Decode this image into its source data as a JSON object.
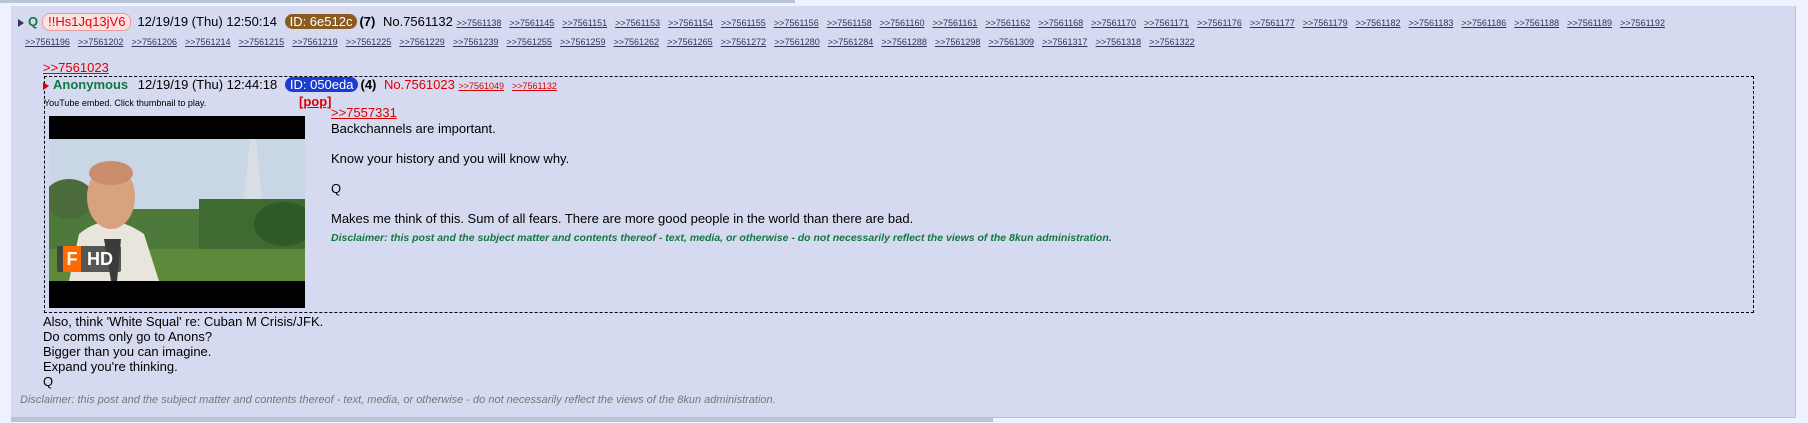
{
  "post": {
    "name": "Q",
    "tripcode": "!!Hs1Jq13jV6",
    "datetime": "12/19/19 (Thu) 12:50:14",
    "id": "ID: 6e512c",
    "id_color": "#8a5a1e",
    "reply_count": "(7)",
    "number": "No.7561132",
    "backlinks_row1": [
      ">>7561138",
      ">>7561145",
      ">>7561151",
      ">>7561153",
      ">>7561154",
      ">>7561155",
      ">>7561156",
      ">>7561158",
      ">>7561160",
      ">>7561161",
      ">>7561162",
      ">>7561168",
      ">>7561170",
      ">>7561171",
      ">>7561176",
      ">>7561177",
      ">>7561179",
      ">>7561182",
      ">>7561183",
      ">>7561186",
      ">>7561188",
      ">>7561189",
      ">>7561192"
    ],
    "backlinks_row2": [
      ">>7561196",
      ">>7561202",
      ">>7561206",
      ">>7561214",
      ">>7561215",
      ">>7561219",
      ">>7561225",
      ">>7561229",
      ">>7561239",
      ">>7561255",
      ">>7561259",
      ">>7561262",
      ">>7561265",
      ">>7561272",
      ">>7561280",
      ">>7561284",
      ">>7561288",
      ">>7561298",
      ">>7561309",
      ">>7561317",
      ">>7561318",
      ">>7561322"
    ],
    "quote_link": ">>7561023",
    "body_lines": [
      "Also, think 'White Squal' re: Cuban M Crisis/JFK.",
      "Do comms only go to Anons?",
      "Bigger than you can imagine.",
      "Expand you're thinking.",
      "Q"
    ],
    "disclaimer": "Disclaimer: this post and the subject matter and contents thereof - text, media, or otherwise - do not necessarily reflect the views of the 8kun administration."
  },
  "inline_post": {
    "name": "Anonymous",
    "datetime": "12/19/19 (Thu) 12:44:18",
    "id": "ID: 050eda",
    "id_color": "#1b3bd1",
    "reply_count": "(4)",
    "number": "No.7561023",
    "backlinks": [
      ">>7561049",
      ">>7561132"
    ],
    "embed_note": "YouTube embed. Click thumbnail to play.",
    "pop_label": "[pop]",
    "hd_label": "HD",
    "hd_logo": "F",
    "quote_link": ">>7557331",
    "body_lines": [
      "Backchannels are important.",
      "Know your history and you will know why.",
      "Q",
      "Makes me think of this.  Sum of all fears.  There are more good people in the world than there are bad."
    ],
    "disclaimer": "Disclaimer: this post and the subject matter and contents thereof - text, media, or otherwise - do not necessarily reflect the views of the 8kun administration."
  }
}
